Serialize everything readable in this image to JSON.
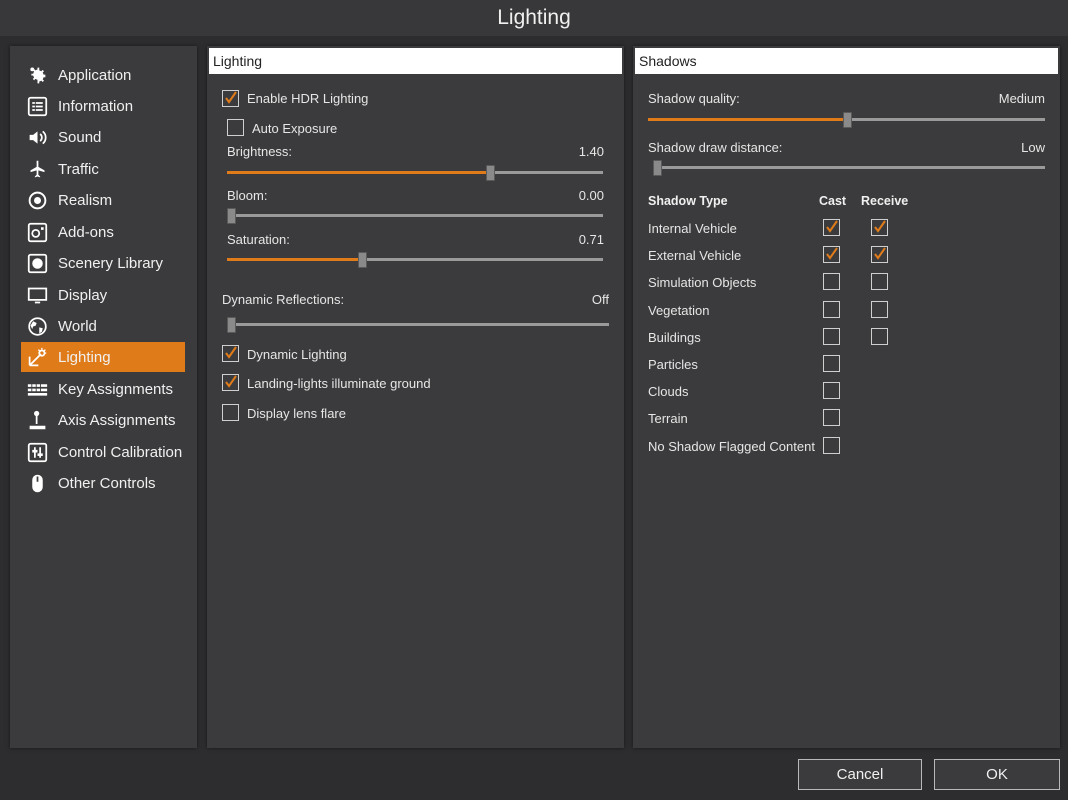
{
  "window": {
    "title": "Lighting"
  },
  "colors": {
    "accent": "#e07b19",
    "panel": "#3b3b3d",
    "background": "#2d2d2f"
  },
  "sidebar": {
    "items": [
      {
        "label": "Application",
        "icon": "gear-icon"
      },
      {
        "label": "Information",
        "icon": "list-icon"
      },
      {
        "label": "Sound",
        "icon": "speaker-icon"
      },
      {
        "label": "Traffic",
        "icon": "airplane-icon"
      },
      {
        "label": "Realism",
        "icon": "realism-icon"
      },
      {
        "label": "Add-ons",
        "icon": "addons-icon"
      },
      {
        "label": "Scenery Library",
        "icon": "scenery-icon"
      },
      {
        "label": "Display",
        "icon": "monitor-icon"
      },
      {
        "label": "World",
        "icon": "globe-icon"
      },
      {
        "label": "Lighting",
        "icon": "lighting-icon",
        "active": true
      },
      {
        "label": "Key Assignments",
        "icon": "keyboard-icon"
      },
      {
        "label": "Axis Assignments",
        "icon": "joystick-icon"
      },
      {
        "label": "Control Calibration",
        "icon": "calibration-icon"
      },
      {
        "label": "Other Controls",
        "icon": "mouse-icon"
      }
    ]
  },
  "lighting": {
    "header": "Lighting",
    "enable_hdr": {
      "label": "Enable HDR Lighting",
      "checked": true
    },
    "auto_exposure": {
      "label": "Auto Exposure",
      "checked": false
    },
    "brightness": {
      "label": "Brightness:",
      "value": "1.40",
      "fraction": 0.7
    },
    "bloom": {
      "label": "Bloom:",
      "value": "0.00",
      "fraction": 0.0
    },
    "saturation": {
      "label": "Saturation:",
      "value": "0.71",
      "fraction": 0.36
    },
    "dynamic_reflections": {
      "label": "Dynamic Reflections:",
      "value": "Off",
      "fraction": 0.0
    },
    "dynamic_lighting": {
      "label": "Dynamic Lighting",
      "checked": true
    },
    "landing_lights": {
      "label": "Landing-lights illuminate ground",
      "checked": true
    },
    "lens_flare": {
      "label": "Display lens flare",
      "checked": false
    }
  },
  "shadows": {
    "header": "Shadows",
    "quality": {
      "label": "Shadow quality:",
      "value": "Medium",
      "fraction": 0.5
    },
    "draw_distance": {
      "label": "Shadow draw distance:",
      "value": "Low",
      "fraction": 0.0
    },
    "table": {
      "col_type": "Shadow Type",
      "col_cast": "Cast",
      "col_receive": "Receive",
      "rows": [
        {
          "label": "Internal Vehicle",
          "cast": true,
          "receive": true
        },
        {
          "label": "External Vehicle",
          "cast": true,
          "receive": true
        },
        {
          "label": "Simulation Objects",
          "cast": false,
          "receive": false
        },
        {
          "label": "Vegetation",
          "cast": false,
          "receive": false
        },
        {
          "label": "Buildings",
          "cast": false,
          "receive": false
        },
        {
          "label": "Particles",
          "cast": false
        },
        {
          "label": "Clouds",
          "cast": false
        },
        {
          "label": "Terrain",
          "cast": false
        },
        {
          "label": "No Shadow Flagged Content",
          "cast": false
        }
      ]
    }
  },
  "buttons": {
    "cancel": "Cancel",
    "ok": "OK"
  }
}
